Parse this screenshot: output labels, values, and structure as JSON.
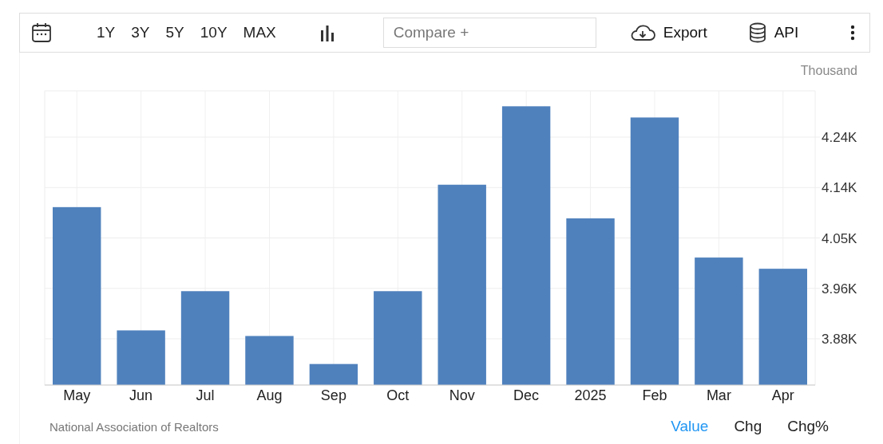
{
  "toolbar": {
    "ranges": [
      {
        "label": "1Y",
        "selected": false
      },
      {
        "label": "3Y",
        "selected": false
      },
      {
        "label": "5Y",
        "selected": false
      },
      {
        "label": "10Y",
        "selected": false
      },
      {
        "label": "MAX",
        "selected": false
      }
    ],
    "compare": {
      "placeholder": "Compare +"
    },
    "export_label": "Export",
    "api_label": "API"
  },
  "chart": {
    "unit": "Thousand",
    "chart_data": {
      "type": "bar",
      "categories": [
        "May",
        "Jun",
        "Jul",
        "Aug",
        "Sep",
        "Oct",
        "Nov",
        "Dec",
        "2025",
        "Feb",
        "Mar",
        "Apr"
      ],
      "grid": true,
      "series": [
        {
          "color": "#4f81bd",
          "values": [
            4.11,
            3.89,
            3.96,
            3.88,
            3.83,
            3.96,
            4.15,
            4.29,
            4.09,
            4.27,
            4.02,
            4.0
          ]
        }
      ],
      "ylim": [
        3.7925,
        4.3175
      ],
      "yticks": [
        {
          "value": 3.875,
          "label": "3.88K"
        },
        {
          "value": 3.965,
          "label": "3.96K"
        },
        {
          "value": 4.055,
          "label": "4.05K"
        },
        {
          "value": 4.145,
          "label": "4.14K"
        },
        {
          "value": 4.235,
          "label": "4.24K"
        }
      ]
    }
  },
  "footer": {
    "source": "National Association of Realtors",
    "modes": [
      {
        "label": "Value",
        "selected": true
      },
      {
        "label": "Chg",
        "selected": false
      },
      {
        "label": "Chg%",
        "selected": false
      }
    ]
  }
}
